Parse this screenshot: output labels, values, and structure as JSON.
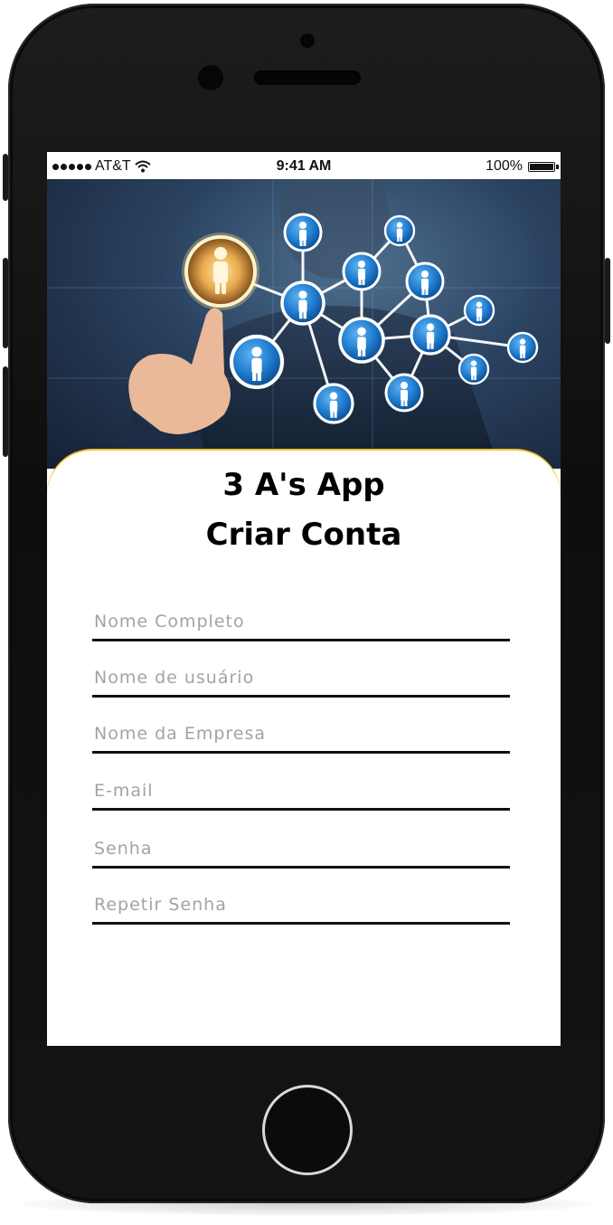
{
  "status_bar": {
    "carrier": "AT&T",
    "time": "9:41 AM",
    "battery": "100%"
  },
  "app": {
    "title": "3 A's App",
    "subtitle": "Criar Conta"
  },
  "form": {
    "fields": [
      {
        "placeholder": "Nome Completo",
        "value": ""
      },
      {
        "placeholder": "Nome de usuário",
        "value": ""
      },
      {
        "placeholder": "Nome da Empresa",
        "value": ""
      },
      {
        "placeholder": "E-mail",
        "value": ""
      },
      {
        "placeholder": "Senha",
        "value": ""
      },
      {
        "placeholder": "Repetir Senha",
        "value": ""
      }
    ]
  },
  "colors": {
    "accent": "#f2c230",
    "node_blue": "#1f7ccf",
    "underline": "#111111",
    "placeholder": "#a3a3a3"
  },
  "icons": [
    "wifi-icon",
    "battery-icon",
    "signal-dots-icon",
    "person-node-icon",
    "home-button"
  ]
}
